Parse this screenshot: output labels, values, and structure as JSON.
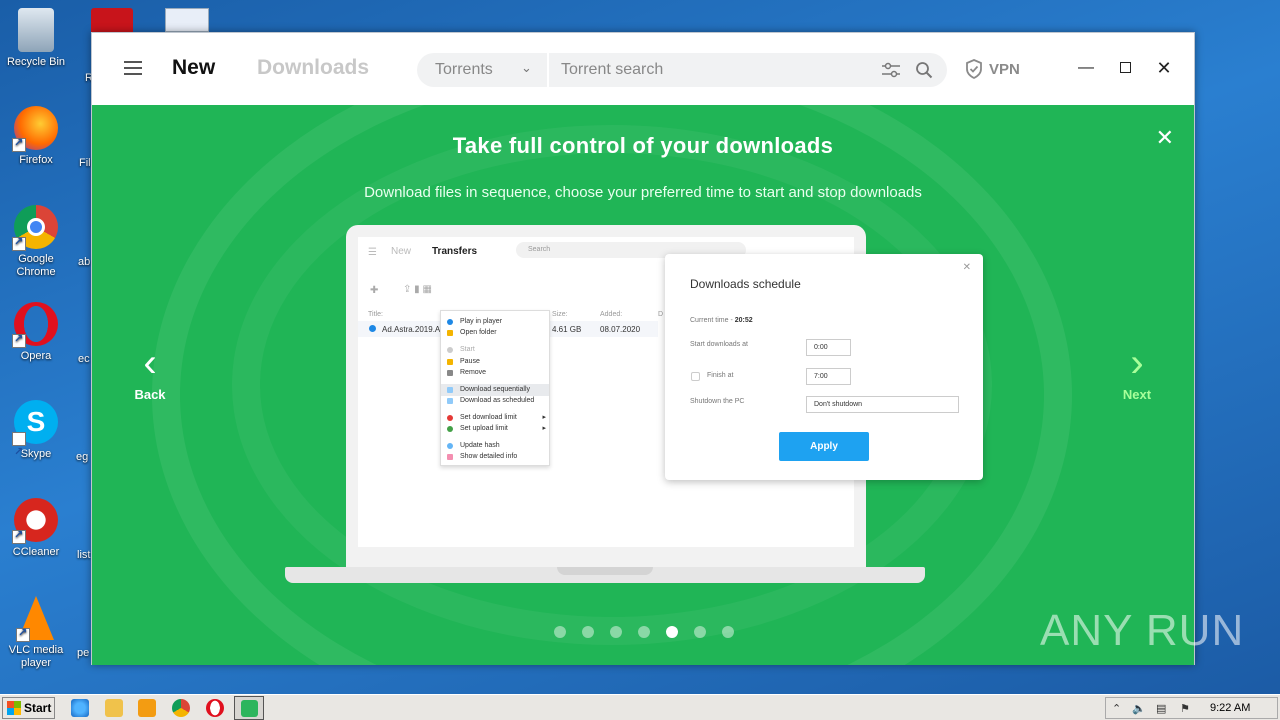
{
  "desktop": {
    "icons": [
      {
        "label": "Recycle Bin"
      },
      {
        "label": "Firefox"
      },
      {
        "label": "Google Chrome"
      },
      {
        "label": "Opera"
      },
      {
        "label": "Skype"
      },
      {
        "label": "CCleaner"
      },
      {
        "label": "VLC media player"
      }
    ],
    "partial_labels": [
      "R",
      "Fil",
      "ab",
      "ec",
      "eg",
      "list",
      "pe"
    ]
  },
  "app": {
    "tabs": {
      "new": "New",
      "downloads": "Downloads"
    },
    "search": {
      "category": "Torrents",
      "placeholder": "Torrent search"
    },
    "vpn_label": "VPN",
    "promo": {
      "title": "Take full control of your downloads",
      "subtitle": "Download files in sequence, choose your preferred time to start and stop downloads",
      "back_label": "Back",
      "next_label": "Next",
      "dots_total": 7,
      "active_dot": 5
    },
    "mockup": {
      "tab_new": "New",
      "tab_transfers": "Transfers",
      "search_placeholder": "Search",
      "col_title": "Title:",
      "col_size": "Size:",
      "col_added": "Added:",
      "col_d": "D",
      "row_name": "Ad.Astra.2019.A",
      "row_size": "4.61 GB",
      "row_added": "08.07.2020",
      "menu": [
        "Play in player",
        "Open folder",
        "Start",
        "Pause",
        "Remove",
        "Download sequentially",
        "Download as scheduled",
        "Set download limit",
        "Set upload limit",
        "Update hash",
        "Show detailed info"
      ],
      "schedule": {
        "title": "Downloads schedule",
        "current_time_label": "Current time - ",
        "current_time": "20:52",
        "start_label": "Start downloads at",
        "start_value": "0:00",
        "finish_label": "Finish at",
        "finish_value": "7:00",
        "shutdown_label": "Shutdown the PC",
        "shutdown_value": "Don't shutdown",
        "apply": "Apply"
      }
    }
  },
  "watermark": "ANY RUN",
  "taskbar": {
    "start_label": "Start",
    "clock": "9:22 AM"
  },
  "colors": {
    "promo_green": "#20b556",
    "next_accent": "#a8ff9a",
    "apply_blue": "#1ea2f1"
  }
}
